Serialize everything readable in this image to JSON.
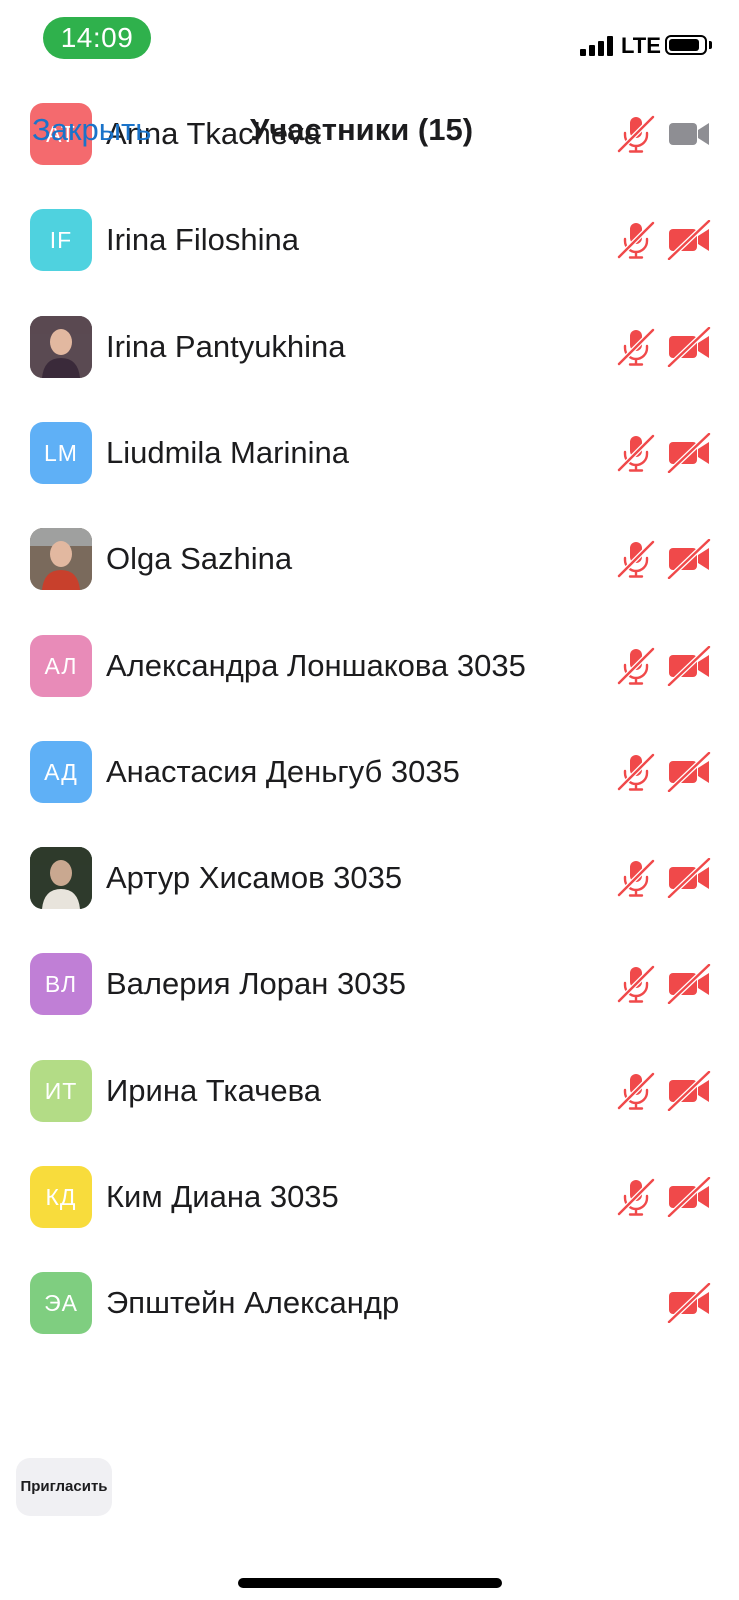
{
  "status_bar": {
    "time": "14:09",
    "network": "LTE"
  },
  "header": {
    "close_label": "Закрыть",
    "title": "Участники (15)"
  },
  "participants": [
    {
      "initials": "AT",
      "name": "Anna Tkacheva",
      "avatar_color": "#f46a6e",
      "avatar_type": "initials",
      "mic": "muted",
      "camera": "on"
    },
    {
      "initials": "IF",
      "name": "Irina Filoshina",
      "avatar_color": "#4fd2df",
      "avatar_type": "initials",
      "mic": "muted",
      "camera": "off"
    },
    {
      "initials": "",
      "name": "Irina Pantyukhina",
      "avatar_color": "#5a4a52",
      "avatar_type": "photo",
      "mic": "muted",
      "camera": "off"
    },
    {
      "initials": "LM",
      "name": "Liudmila Marinina",
      "avatar_color": "#5fb0f6",
      "avatar_type": "initials",
      "mic": "muted",
      "camera": "off"
    },
    {
      "initials": "",
      "name": "Olga Sazhina",
      "avatar_color": "#7a6a5c",
      "avatar_type": "photo",
      "mic": "muted",
      "camera": "off"
    },
    {
      "initials": "АЛ",
      "name": "Александра Лоншакова 3035",
      "avatar_color": "#e88bb8",
      "avatar_type": "initials",
      "mic": "muted",
      "camera": "off"
    },
    {
      "initials": "АД",
      "name": "Анастасия Деньгуб 3035",
      "avatar_color": "#5fb0f6",
      "avatar_type": "initials",
      "mic": "muted",
      "camera": "off"
    },
    {
      "initials": "",
      "name": "Артур Хисамов 3035",
      "avatar_color": "#2e3a2c",
      "avatar_type": "photo",
      "mic": "muted",
      "camera": "off"
    },
    {
      "initials": "ВЛ",
      "name": "Валерия Лоран 3035",
      "avatar_color": "#c07fd6",
      "avatar_type": "initials",
      "mic": "muted",
      "camera": "off"
    },
    {
      "initials": "ИТ",
      "name": "Ирина Ткачева",
      "avatar_color": "#b3dc86",
      "avatar_type": "initials",
      "mic": "muted",
      "camera": "off"
    },
    {
      "initials": "КД",
      "name": "Ким Диана 3035",
      "avatar_color": "#f8dc3c",
      "avatar_type": "initials",
      "mic": "muted",
      "camera": "off"
    },
    {
      "initials": "ЭА",
      "name": "Эпштейн Александр",
      "avatar_color": "#7fce80",
      "avatar_type": "initials",
      "mic": "none",
      "camera": "off"
    }
  ],
  "invite_label": "Пригласить",
  "icons": {
    "muted_color": "#f0494a",
    "camera_on_color": "#8e8e93"
  }
}
